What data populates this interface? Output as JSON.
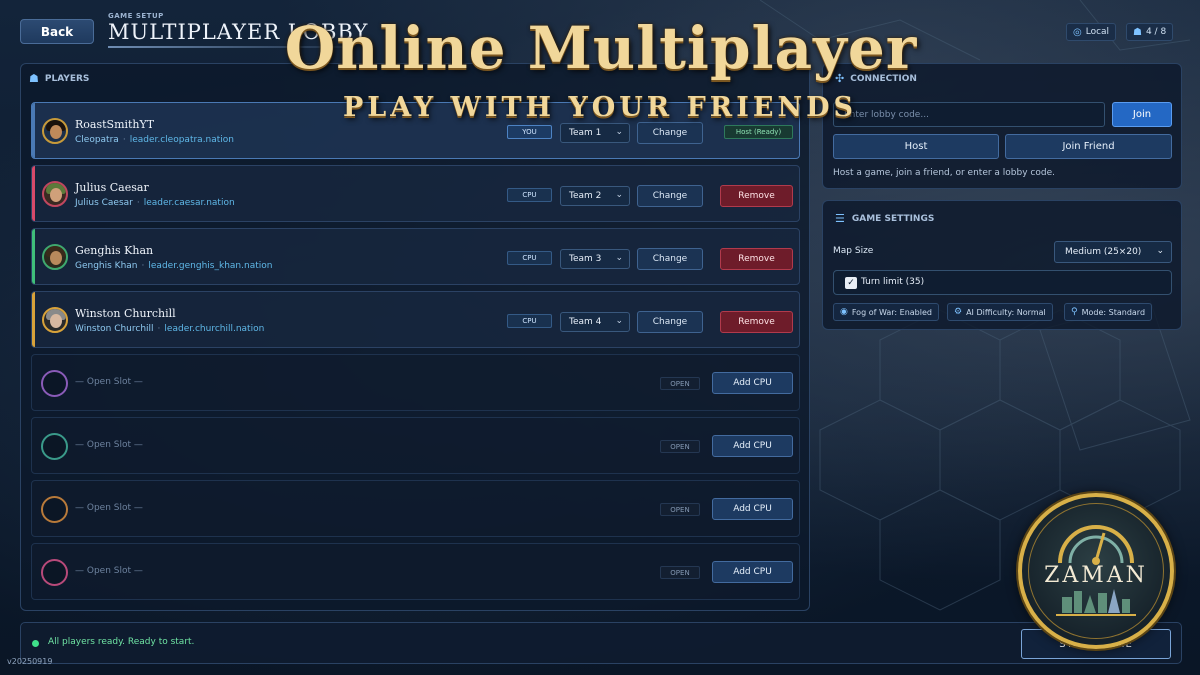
{
  "topbar": {
    "back_label": "Back",
    "kicker": "GAME SETUP",
    "title": "MULTIPLAYER LOBBY",
    "network_label": "Local",
    "player_count": "4 / 8"
  },
  "banner": {
    "title": "Online Multiplayer",
    "subtitle": "PLAY WITH YOUR FRIENDS"
  },
  "players_panel": {
    "heading": "PLAYERS",
    "players": [
      {
        "name": "RoastSmithYT",
        "civ": "Cleopatra",
        "address": "leader.cleopatra.nation",
        "badge": "YOU",
        "team": "Team 1",
        "change_label": "Change",
        "status": "Host (Ready)",
        "accent": "#4a79b4"
      },
      {
        "name": "Julius Caesar",
        "civ": "Julius Caesar",
        "address": "leader.caesar.nation",
        "badge": "CPU",
        "team": "Team 2",
        "change_label": "Change",
        "remove_label": "Remove",
        "accent": "#d84a6a"
      },
      {
        "name": "Genghis Khan",
        "civ": "Genghis Khan",
        "address": "leader.genghis_khan.nation",
        "badge": "CPU",
        "team": "Team 3",
        "change_label": "Change",
        "remove_label": "Remove",
        "accent": "#3fbf7a"
      },
      {
        "name": "Winston Churchill",
        "civ": "Winston Churchill",
        "address": "leader.churchill.nation",
        "badge": "CPU",
        "team": "Team 4",
        "change_label": "Change",
        "remove_label": "Remove",
        "accent": "#d8a23a"
      }
    ],
    "open_slots": [
      {
        "label": "— Open Slot —",
        "badge": "OPEN",
        "button": "Add CPU",
        "ring_color": "#8a5bb8"
      },
      {
        "label": "— Open Slot —",
        "badge": "OPEN",
        "button": "Add CPU",
        "ring_color": "#3a9a8a"
      },
      {
        "label": "— Open Slot —",
        "badge": "OPEN",
        "button": "Add CPU",
        "ring_color": "#b87a3a"
      },
      {
        "label": "— Open Slot —",
        "badge": "OPEN",
        "button": "Add CPU",
        "ring_color": "#b84a7a"
      }
    ]
  },
  "connection": {
    "heading": "CONNECTION",
    "lobby_placeholder": "Enter lobby code...",
    "join_label": "Join",
    "host_label": "Host",
    "join_friend_label": "Join Friend",
    "hint": "Host a game, join a friend, or enter a lobby code."
  },
  "game_settings": {
    "heading": "GAME SETTINGS",
    "map_size_label": "Map Size",
    "map_size_value": "Medium (25×20)",
    "turn_limit_label": "Turn limit (35)",
    "turn_limit_checked": true,
    "tags": [
      "Fog of War: Enabled",
      "AI Difficulty: Normal",
      "Mode: Standard"
    ]
  },
  "status": {
    "text": "All players ready. Ready to start.",
    "start_label": "START GAME",
    "version": "v20250919"
  },
  "logo": {
    "text": "ZAMAN"
  },
  "colors": {
    "accent": "#2468c4",
    "ready": "#3fe08a",
    "danger": "#6e1c2a",
    "gold": "#f1d79a"
  }
}
